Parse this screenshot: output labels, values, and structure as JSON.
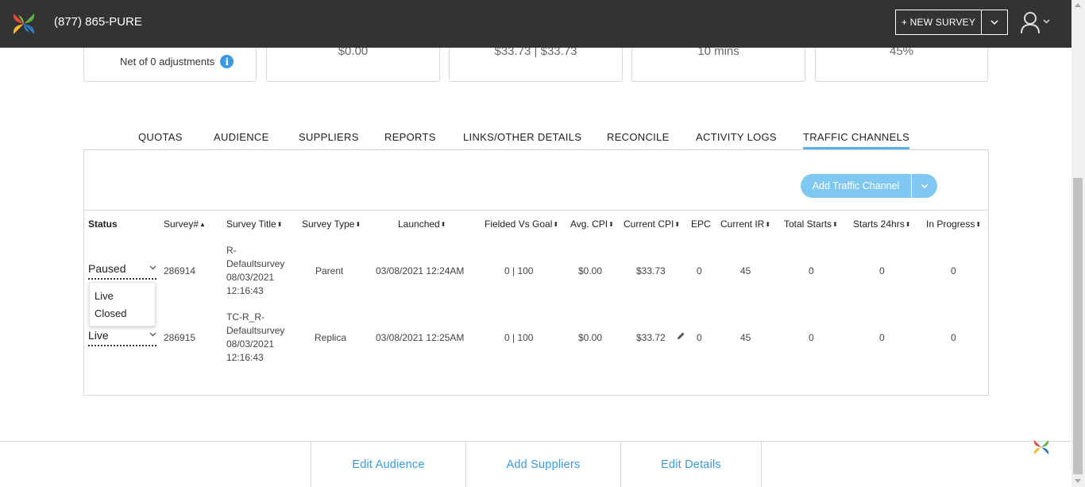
{
  "header": {
    "phone": "(877) 865-PURE",
    "new_survey_label": "+ NEW SURVEY"
  },
  "cards": {
    "card0_sub": "Net of 0 adjustments",
    "card1_value": "$0.00",
    "card2_value": "$33.73 | $33.73",
    "card3_value": "10 mins",
    "card4_value": "45%"
  },
  "tabs": [
    "QUOTAS",
    "AUDIENCE",
    "SUPPLIERS",
    "REPORTS",
    "LINKS/OTHER DETAILS",
    "RECONCILE",
    "ACTIVITY LOGS",
    "TRAFFIC CHANNELS"
  ],
  "active_tab": "TRAFFIC CHANNELS",
  "add_traffic_channel_label": "Add Traffic Channel",
  "table": {
    "columns": [
      "Status",
      "Survey#",
      "Survey Title",
      "Survey Type",
      "Launched",
      "Fielded Vs Goal",
      "Avg. CPI",
      "Current CPI",
      "EPC",
      "Current IR",
      "Total Starts",
      "Starts 24hrs",
      "In Progress"
    ],
    "rows": [
      {
        "status": "Paused",
        "survey_no": "286914",
        "title_lines": [
          "R-",
          "Defaultsurvey",
          "08/03/2021",
          "12:16:43"
        ],
        "type": "Parent",
        "launched": "03/08/2021 12:24AM",
        "fielded_vs_goal": "0 | 100",
        "avg_cpi": "$0.00",
        "current_cpi": "$33.73",
        "epc": "0",
        "current_ir": "45",
        "total_starts": "0",
        "starts_24hrs": "0",
        "in_progress": "0"
      },
      {
        "status": "Live",
        "survey_no": "286915",
        "title_lines": [
          "TC-R_R-",
          "Defaultsurvey",
          "08/03/2021",
          "12:16:43"
        ],
        "type": "Replica",
        "launched": "03/08/2021 12:25AM",
        "fielded_vs_goal": "0 | 100",
        "avg_cpi": "$0.00",
        "current_cpi": "$33.72",
        "epc": "0",
        "current_ir": "45",
        "total_starts": "0",
        "starts_24hrs": "0",
        "in_progress": "0"
      }
    ],
    "status_dropdown_options": [
      "Live",
      "Closed"
    ]
  },
  "bottom": {
    "edit_audience": "Edit Audience",
    "add_suppliers": "Add Suppliers",
    "edit_details": "Edit Details"
  },
  "colors": {
    "header_bg": "#333333",
    "accent": "#3a9ae0",
    "add_button": "#7ec8f2"
  }
}
